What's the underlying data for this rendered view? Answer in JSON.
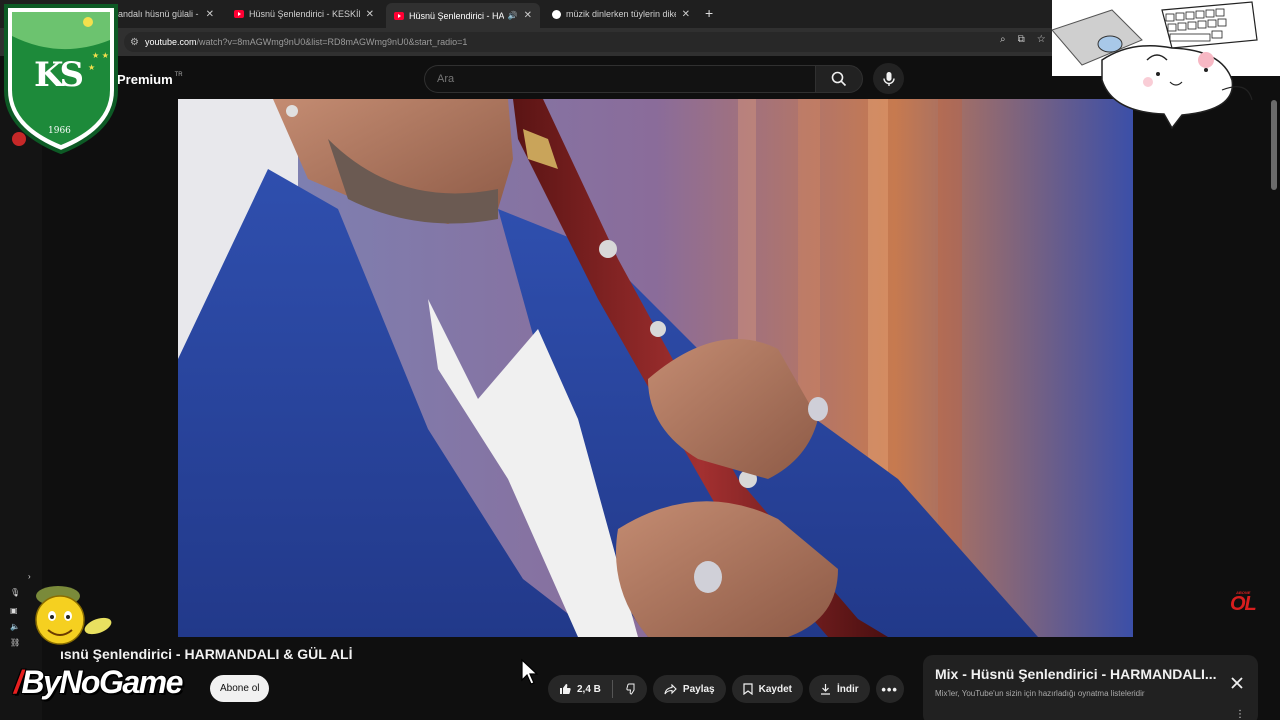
{
  "browser": {
    "tabs": [
      {
        "title": "andalı hüsnü gülali - YouT",
        "icon": "youtube-icon"
      },
      {
        "title": "Hüsnü Şenlendirici - KESKİN BI",
        "icon": "youtube-icon"
      },
      {
        "title": "Hüsnü Şenlendirici - HARM",
        "icon": "youtube-icon",
        "active": true,
        "audio": true
      },
      {
        "title": "müzik dinlerken tüylerin diken",
        "icon": "google-icon"
      }
    ],
    "url_host": "youtube.com",
    "url_path": "/watch?v=8mAGWmg9nU0&list=RD8mAGWmg9nU0&start_radio=1"
  },
  "youtube": {
    "logo_text": "Premium",
    "region": "TR",
    "search_placeholder": "Ara"
  },
  "video": {
    "title": "Hüsnü Şenlendirici - HARMANDALI & GÜL ALİ",
    "title_visible": "ısnü Şenlendirici - HARMANDALI & GÜL ALİ",
    "subscribe_label": "Abone ol",
    "likes": "2,4 B",
    "share_label": "Paylaş",
    "save_label": "Kaydet",
    "download_label": "İndir"
  },
  "overlays": {
    "club_logo_text": "KS",
    "club_logo_year": "1966",
    "channel_badge": "ByNoGame",
    "corner_badge": "OL",
    "corner_badge_small": "ABONE"
  },
  "mix_panel": {
    "title": "Mix - Hüsnü Şenlendirici - HARMANDALI...",
    "subtitle": "Mix'ler, YouTube'un sizin için hazırladığı oynatma listeleridir"
  },
  "colors": {
    "background": "#0f0f0f",
    "accent_red": "#ff0033",
    "club_green": "#1d8a3a"
  }
}
